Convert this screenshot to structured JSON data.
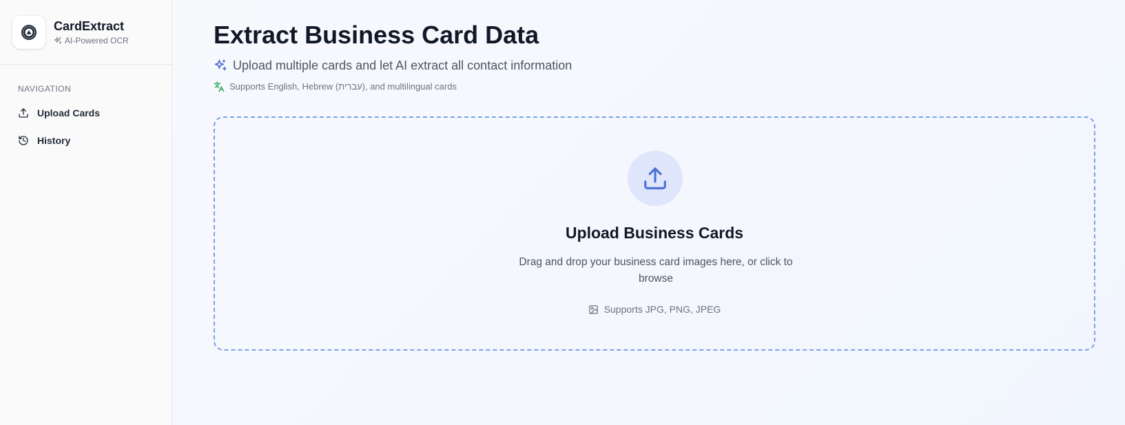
{
  "brand": {
    "name": "CardExtract",
    "tagline": "AI-Powered OCR"
  },
  "sidebar": {
    "heading": "NAVIGATION",
    "items": [
      {
        "label": "Upload Cards",
        "icon": "upload-icon"
      },
      {
        "label": "History",
        "icon": "history-icon"
      }
    ]
  },
  "main": {
    "title": "Extract Business Card Data",
    "subtitle": "Upload multiple cards and let AI extract all contact information",
    "subtitle_icon": "sparkles-icon",
    "languages_note": "Supports English, Hebrew (עברית), and multilingual cards",
    "languages_icon": "languages-icon"
  },
  "dropzone": {
    "icon": "upload-icon",
    "title": "Upload Business Cards",
    "description": "Drag and drop your business card images here, or click to browse",
    "formats": "Supports JPG, PNG, JPEG",
    "formats_icon": "image-icon"
  },
  "colors": {
    "accent": "#4f6fd8",
    "accent_light": "#dfe6fb",
    "dropzone_border": "#7aa0e8",
    "languages_icon": "#22a35a"
  }
}
